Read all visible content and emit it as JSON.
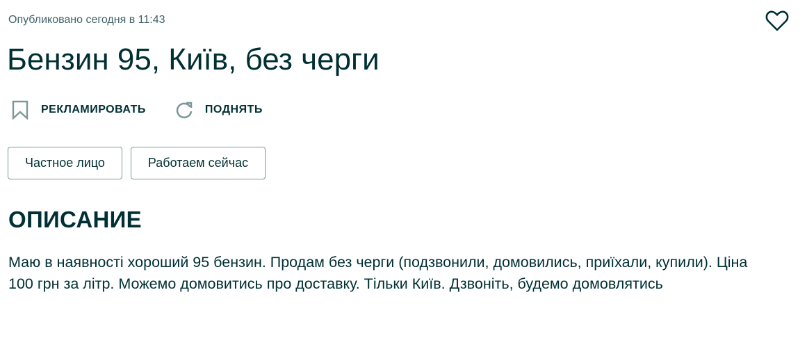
{
  "published": "Опубликовано сегодня в 11:43",
  "title": "Бензин 95, Київ, без черги",
  "actions": {
    "promote_label": "РЕКЛАМИРОВАТЬ",
    "raise_label": "ПОДНЯТЬ"
  },
  "tags": [
    {
      "label": "Частное лицо"
    },
    {
      "label": "Работаем сейчас"
    }
  ],
  "description": {
    "heading": "ОПИСАНИЕ",
    "text": "Маю в наявності хороший 95 бензин. Продам без черги (подзвонили, домовились, приїхали, купили). Ціна 100 грн за літр. Можемо домовитись про доставку. Тільки Київ. Дзвоніть, будемо домовлятись"
  },
  "icons": {
    "favorite": "heart-icon",
    "promote": "bookmark-icon",
    "raise": "refresh-icon"
  },
  "colors": {
    "text": "#002f34",
    "muted": "#406367",
    "border": "#7f9799",
    "icon": "#7f9799"
  }
}
